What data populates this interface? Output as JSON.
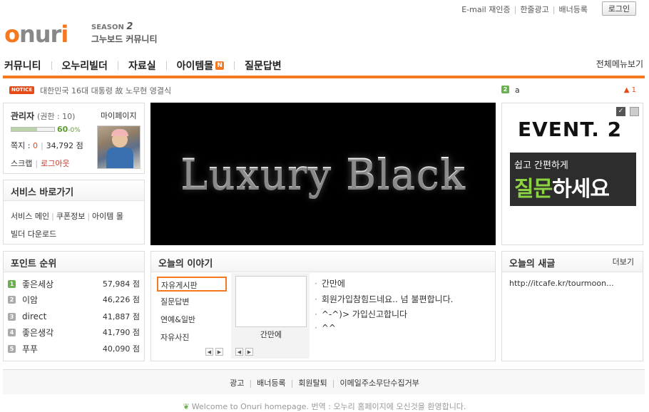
{
  "top": {
    "links": [
      "E-mail 재인증",
      "한줄광고",
      "배너등록"
    ],
    "login_label": "로그인"
  },
  "logo": {
    "wordmark": "onuri",
    "season_prefix": "SEASON",
    "season_num": "2",
    "tagline": "그누보드 커뮤니티"
  },
  "gnb": {
    "items": [
      "커뮤니티",
      "오누리빌더",
      "자료실",
      "아이템몰",
      "질문답변"
    ],
    "badge": "N",
    "all_menu": "전체메뉴보기"
  },
  "notice": {
    "tag": "NOTICE",
    "text": "대한민국 16대 대통령 故 노무현 영결식"
  },
  "ranking_ticker": {
    "num": "2",
    "word": "a",
    "change": "1"
  },
  "user": {
    "name": "관리자",
    "level": "(권한 : 10)",
    "mypage": "마이페이지",
    "progress_percent": 60,
    "progress_label": "60",
    "progress_label_suffix": "-0%",
    "mail_label": "쪽지 :",
    "mail_count": "0",
    "points": "34,792 점",
    "scrap": "스크랩",
    "logout": "로그아웃"
  },
  "service": {
    "title": "서비스 바로가기",
    "links": [
      "서비스 메인",
      "쿠폰정보",
      "아이템 몰",
      "빌더 다운로드"
    ]
  },
  "banner": {
    "text": "Luxury Black"
  },
  "event": {
    "title": "EVENT. 2",
    "small": "쉽고 간편하게",
    "big_highlight": "질문",
    "big_rest": "하세요"
  },
  "points_rank": {
    "title": "포인트 순위",
    "rows": [
      {
        "rank": "1",
        "name": "좋은세상",
        "points": "57,984 점"
      },
      {
        "rank": "2",
        "name": "이암",
        "points": "46,226 점"
      },
      {
        "rank": "3",
        "name": "direct",
        "points": "41,887 점"
      },
      {
        "rank": "4",
        "name": "좋은생각",
        "points": "41,790 점"
      },
      {
        "rank": "5",
        "name": "푸푸",
        "points": "40,090 점"
      }
    ]
  },
  "story": {
    "title": "오늘의 이야기",
    "categories": [
      "자유게시판",
      "질문답변",
      "연예&일반",
      "자유사진"
    ],
    "thumb_caption": "간만에",
    "lines": [
      "간만에",
      "회원가입참힘드네요.. 넘 불편합니다.",
      "^-^)> 가입신고합니다",
      "^^"
    ],
    "arrow_prev": "◀",
    "arrow_next": "▶"
  },
  "today_post": {
    "title": "오늘의 새글",
    "more": "더보기",
    "link": "http://itcafe.kr/tourmoon..."
  },
  "footer": {
    "links": [
      "광고",
      "배너등록",
      "회원탈퇴",
      "이메일주소무단수집거부"
    ],
    "copy": "Welcome to Onuri homepage. 번역 : 오누리 홈페이지에 오신것을 환영합니다."
  },
  "colors": {
    "accent": "#f47920",
    "green": "#6ab04c",
    "notice": "#e64a19"
  }
}
